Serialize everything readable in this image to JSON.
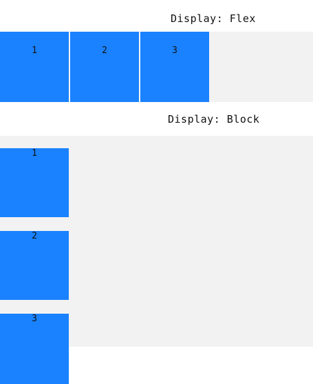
{
  "sections": {
    "flex": {
      "title": "Display: Flex",
      "items": [
        "1",
        "2",
        "3"
      ]
    },
    "block": {
      "title": "Display: Block",
      "items": [
        "1",
        "2",
        "3"
      ]
    }
  },
  "colors": {
    "box": "#1a82ff",
    "container": "#f2f2f2",
    "text": "#111111"
  }
}
